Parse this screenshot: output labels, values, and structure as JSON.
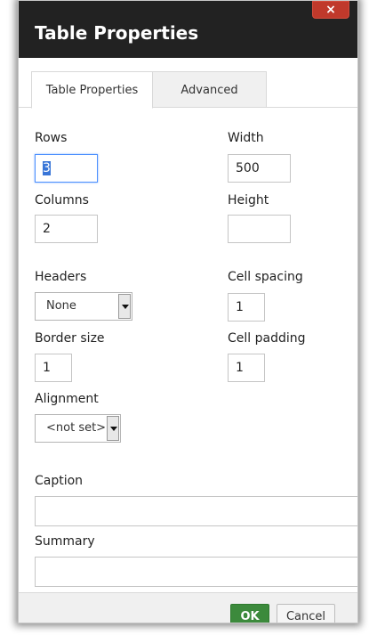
{
  "dialog": {
    "title": "Table Properties",
    "close_label": "×"
  },
  "tabs": [
    {
      "label": "Table Properties",
      "active": true
    },
    {
      "label": "Advanced",
      "active": false
    }
  ],
  "form": {
    "rows_label": "Rows",
    "rows_value": "3",
    "width_label": "Width",
    "width_value": "500",
    "columns_label": "Columns",
    "columns_value": "2",
    "height_label": "Height",
    "height_value": "",
    "headers_label": "Headers",
    "headers_value": "None",
    "cell_spacing_label": "Cell spacing",
    "cell_spacing_value": "1",
    "border_size_label": "Border size",
    "border_size_value": "1",
    "cell_padding_label": "Cell padding",
    "cell_padding_value": "1",
    "alignment_label": "Alignment",
    "alignment_value": "<not set>",
    "caption_label": "Caption",
    "caption_value": "",
    "summary_label": "Summary",
    "summary_value": ""
  },
  "footer": {
    "ok_label": "OK",
    "cancel_label": "Cancel"
  },
  "colors": {
    "titlebar": "#222222",
    "close": "#c0392b",
    "ok": "#3c8a3c",
    "focus": "#4d90fe"
  }
}
